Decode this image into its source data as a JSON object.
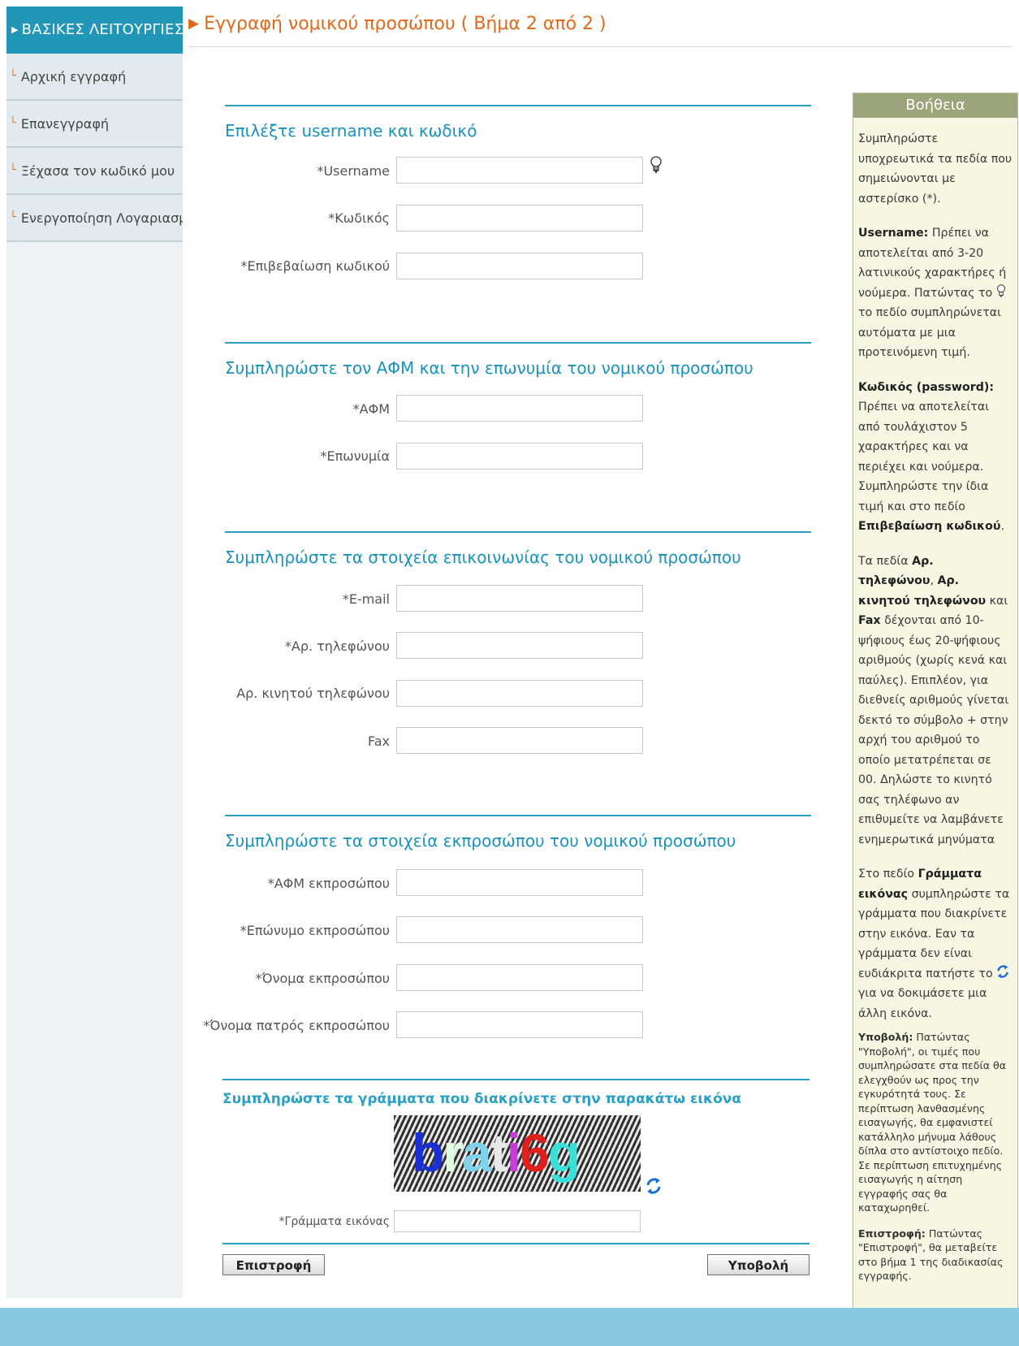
{
  "sidebar": {
    "header": "ΒΑΣΙΚΕΣ ΛΕΙΤΟΥΡΓΙΕΣ",
    "items": [
      {
        "label": "Αρχική εγγραφή"
      },
      {
        "label": "Επανεγγραφή"
      },
      {
        "label": "Ξέχασα τον κωδικό μου"
      },
      {
        "label": "Ενεργοποίηση Λογαριασμού"
      }
    ]
  },
  "page": {
    "title": "Εγγραφή νομικού προσώπου ( Βήμα 2 από 2 )"
  },
  "sections": {
    "credentials": {
      "title": "Επιλέξτε username και κωδικό",
      "username_label": "*Username",
      "password_label": "*Κωδικός",
      "confirm_label": "*Επιβεβαίωση κωδικού"
    },
    "company": {
      "title": "Συμπληρώστε τον ΑΦΜ και την επωνυμία του νομικού προσώπου",
      "afm_label": "*ΑΦΜ",
      "name_label": "*Επωνυμία"
    },
    "contact": {
      "title": "Συμπληρώστε τα στοιχεία επικοινωνίας του νομικού προσώπου",
      "email_label": "*E-mail",
      "phone_label": "*Αρ. τηλεφώνου",
      "mobile_label": "Αρ. κινητού τηλεφώνου",
      "fax_label": "Fax"
    },
    "representative": {
      "title": "Συμπληρώστε τα στοιχεία εκπροσώπου του νομικού προσώπου",
      "afm_label": "*ΑΦΜ εκπροσώπου",
      "surname_label": "*Επώνυμο εκπροσώπου",
      "firstname_label": "*Όνομα εκπροσώπου",
      "father_label": "*Όνομα πατρός εκπροσώπου"
    },
    "captcha": {
      "title": "Συμπληρώστε τα γράμματα που διακρίνετε στην παρακάτω εικόνα",
      "image_text": "brati6g",
      "input_label": "*Γράμματα εικόνας"
    }
  },
  "buttons": {
    "back": "Επιστροφή",
    "submit": "Υποβολή"
  },
  "help": {
    "title": "Βοήθεια",
    "p1": "Συμπληρώστε υποχρεωτικά τα πεδία που σημειώνονται με αστερίσκο (*).",
    "username_title": "Username:",
    "username_text_a": "Πρέπει να αποτελείται από 3-20 λατινικούς χαρακτήρες ή",
    "username_text_b": "νούμερα. Πατώντας το",
    "username_text_c": "το πεδίο συμπληρώνεται αυτόματα με μια προτεινόμενη τιμή.",
    "password_title": "Κωδικός (password):",
    "password_text_a": "Πρέπει να αποτελείται από τουλάχιστον 5 χαρακτήρες και να περιέχει και νούμερα. Συμπληρώστε την ίδια τιμή και στο πεδίο",
    "password_text_b": "Επιβεβαίωση κωδικού",
    "password_text_c": ".",
    "phones_a": "Τα πεδία",
    "phones_b": "Αρ. τηλεφώνου",
    "phones_c": ",",
    "phones_d": "Αρ. κινητού τηλεφώνου",
    "phones_e": "και",
    "phones_f": "Fax",
    "phones_g": "δέχονται από 10-ψήφιους έως 20-ψήφιους αριθμούς (χωρίς κενά και παύλες). Επιπλέον, για διεθνείς αριθμούς γίνεται δεκτό το σύμβολο + στην αρχή του αριθμού το οποίο μετατρέπεται σε 00. Δηλώστε το κινητό σας τηλέφωνο αν επιθυμείτε να λαμβάνετε ενημερωτικά μηνύματα",
    "captcha_a": "Στο πεδίο",
    "captcha_b": "Γράμματα εικόνας",
    "captcha_c": "συμπληρώστε τα γράμματα που διακρίνετε στην εικόνα. Εαν τα γράμματα δεν είναι",
    "captcha_d": "ευδιάκριτα πατήστε το",
    "captcha_e": "για να δοκιμάσετε μια άλλη εικόνα.",
    "submit_title": "Υποβολή:",
    "submit_text": "Πατώντας \"Υποβολή\", οι τιμές που συμπληρώσατε στα πεδία θα ελεγχθούν ως προς την εγκυρότητά τους. Σε περίπτωση λανθασμένης εισαγωγής, θα εμφανιστεί κατάλληλο μήνυμα λάθους δίπλα στο αντίστοιχο πεδίο. Σε περίπτωση επιτυχημένης εισαγωγής η αίτηση εγγραφής σας θα καταχωρηθεί.",
    "back_title": "Επιστροφή:",
    "back_text": "Πατώντας \"Επιστροφή\", θα μεταβείτε στο βήμα 1 της διαδικασίας εγγραφής."
  },
  "colors": {
    "sidebar_header": "#2196b6",
    "section_title": "#1a93bb",
    "page_title": "#e06a1c",
    "help_header": "#9aa57b",
    "footer_band": "#86c9e0"
  },
  "icons": {
    "bulb": "lightbulb-icon",
    "refresh": "refresh-icon"
  }
}
